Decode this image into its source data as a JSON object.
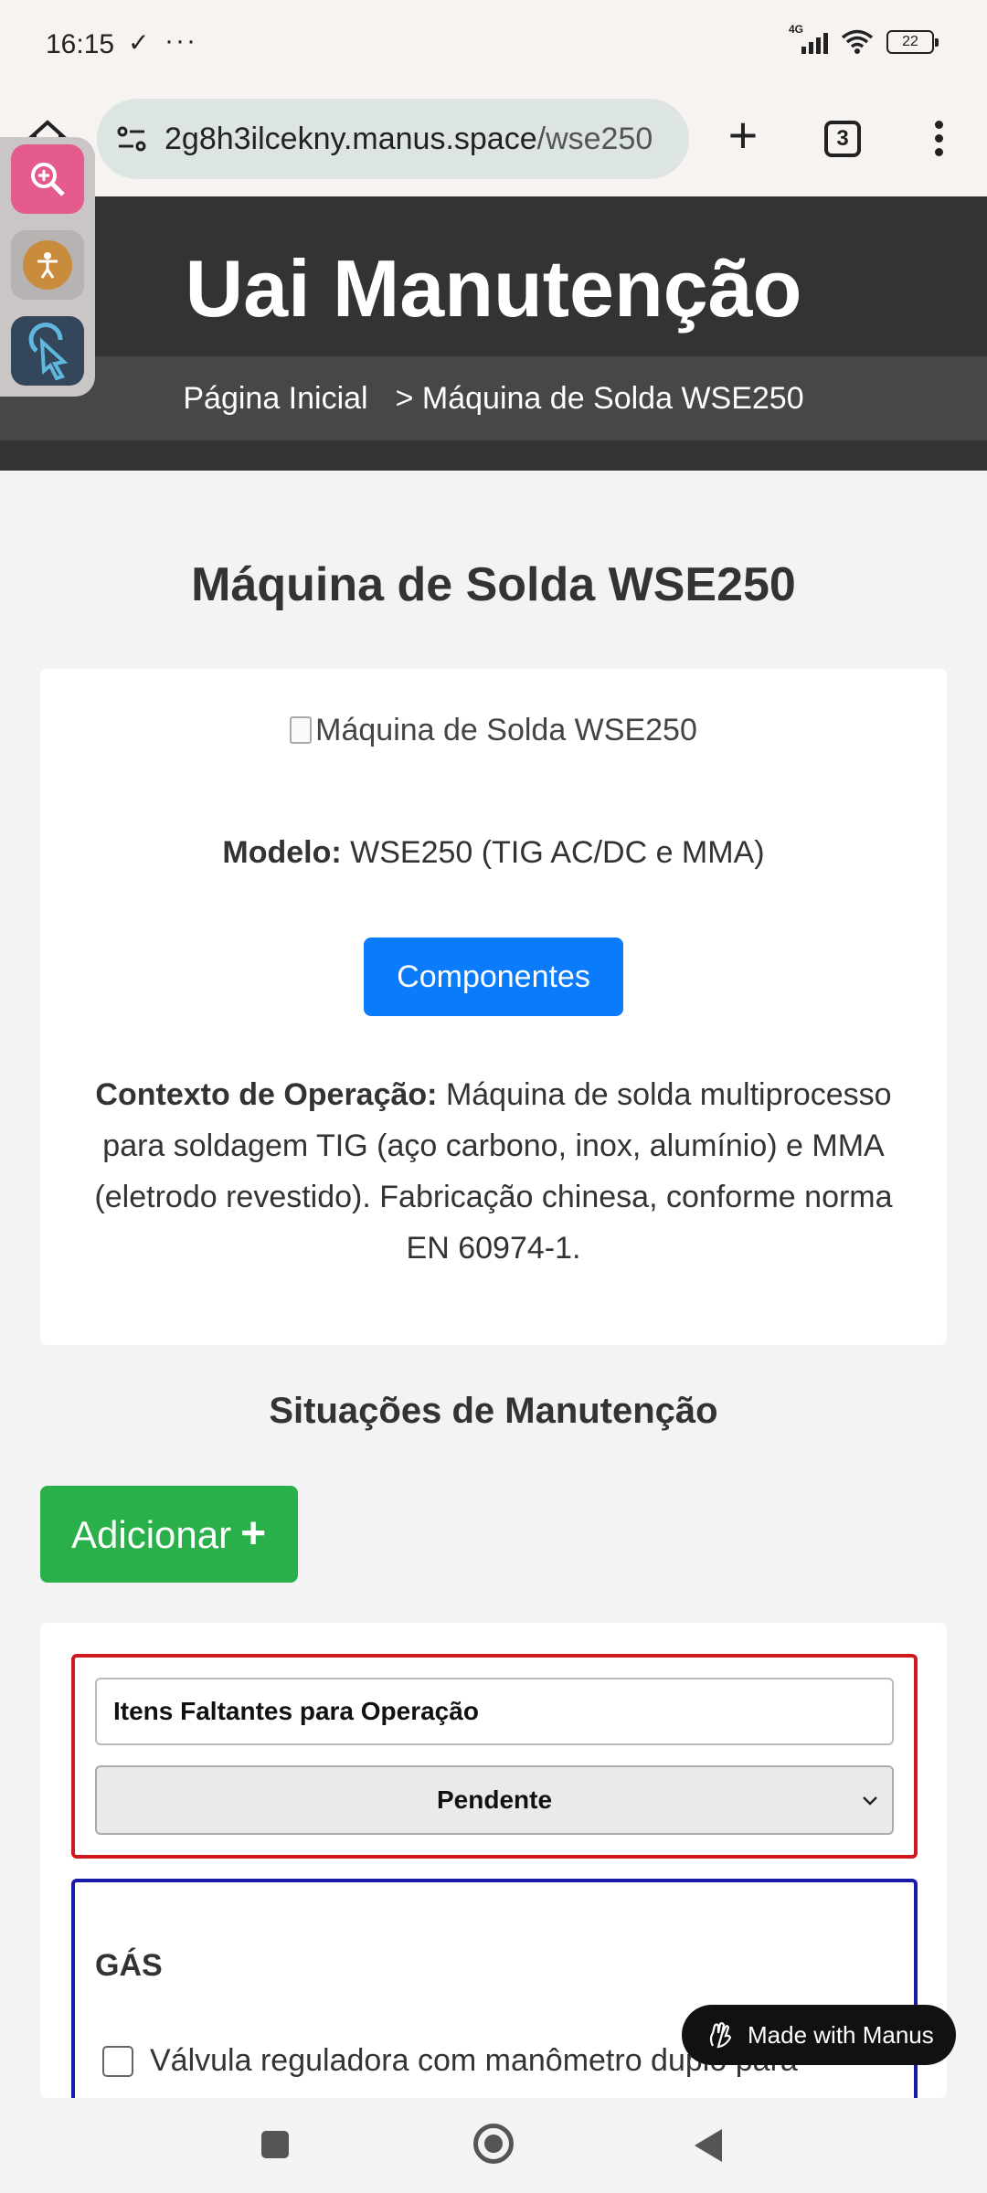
{
  "status_bar": {
    "time": "16:15",
    "check_glyph": "✓",
    "more_glyph": "···",
    "network": "4G",
    "battery": "22"
  },
  "browser": {
    "url_host": "2g8h3ilcekny.manus.space",
    "url_path": "/wse250",
    "plus_label": "+",
    "tab_count": "3",
    "icons": [
      "home-icon",
      "site-settings-icon",
      "new-tab-icon",
      "tab-switcher-icon",
      "more-vert-icon"
    ]
  },
  "accessibility_widget": {
    "icons": [
      "zoom-in-icon",
      "accessibility-person-icon",
      "pointer-click-icon"
    ],
    "colors": {
      "zoom": "#e55b8e",
      "person": "#c98b3c",
      "pointer": "#33465c"
    }
  },
  "header": {
    "title": "Uai Manutenção",
    "breadcrumb_home": "Página Inicial",
    "breadcrumb_current": "> Máquina de Solda WSE250"
  },
  "main": {
    "title": "Máquina de Solda WSE250",
    "image_alt": "Máquina de Solda WSE250",
    "model_label": "Modelo:",
    "model_value": " WSE250 (TIG AC/DC e MMA)",
    "components_button": "Componentes",
    "context_label": "Contexto de Operação:",
    "context_text": " Máquina de solda multiprocesso para soldagem TIG (aço carbono, inox, alumínio) e MMA (eletrodo revestido). Fabricação chinesa, conforme norma EN 60974-1."
  },
  "maintenance": {
    "section_title": "Situações de Manutenção",
    "add_button": "Adicionar",
    "add_icon": "+",
    "task_title": "Itens Faltantes para Operação",
    "status_value": "Pendente",
    "group_title": "GÁS",
    "first_item": "Válvula reguladora com manômetro duplo para",
    "colors": {
      "pending_border": "#d0181f",
      "group_border": "#1a1aa8",
      "add_button": "#2ab04a",
      "primary_button": "#0a7cfb"
    }
  },
  "badge": {
    "label": "Made with Manus"
  }
}
